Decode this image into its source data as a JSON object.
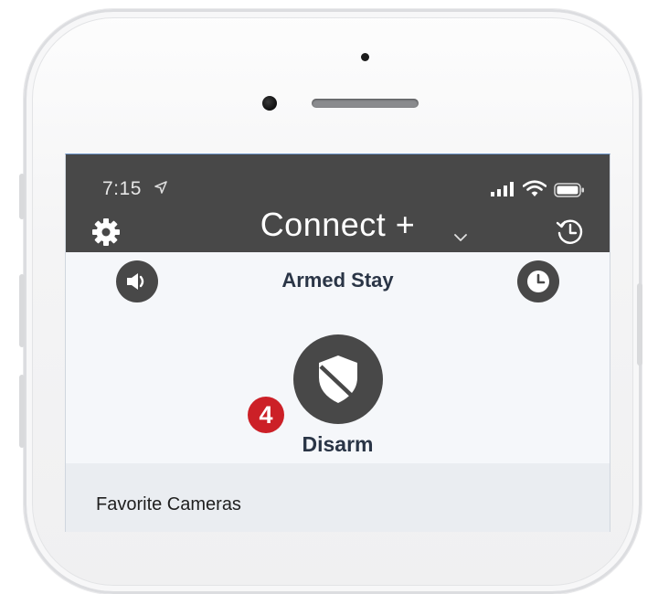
{
  "status_bar": {
    "time": "7:15",
    "location_icon": "location-arrow-icon",
    "signal_icon": "signal-bars-icon",
    "wifi_icon": "wifi-icon",
    "battery_icon": "battery-icon"
  },
  "header": {
    "title": "Connect +",
    "settings_icon": "gear-icon",
    "dropdown_icon": "chevron-down-icon",
    "history_icon": "history-icon"
  },
  "security": {
    "status": "Armed Stay",
    "mute_icon": "speaker-icon",
    "delay_icon": "clock-icon",
    "action_icon": "shield-icon",
    "action_label": "Disarm"
  },
  "callout": {
    "number": "4",
    "color": "#cc2027"
  },
  "sections": {
    "favorite_cameras": "Favorite Cameras"
  },
  "colors": {
    "header_bg": "#484848",
    "screen_bg": "#f5f7fa",
    "text_dark": "#2a3546"
  }
}
